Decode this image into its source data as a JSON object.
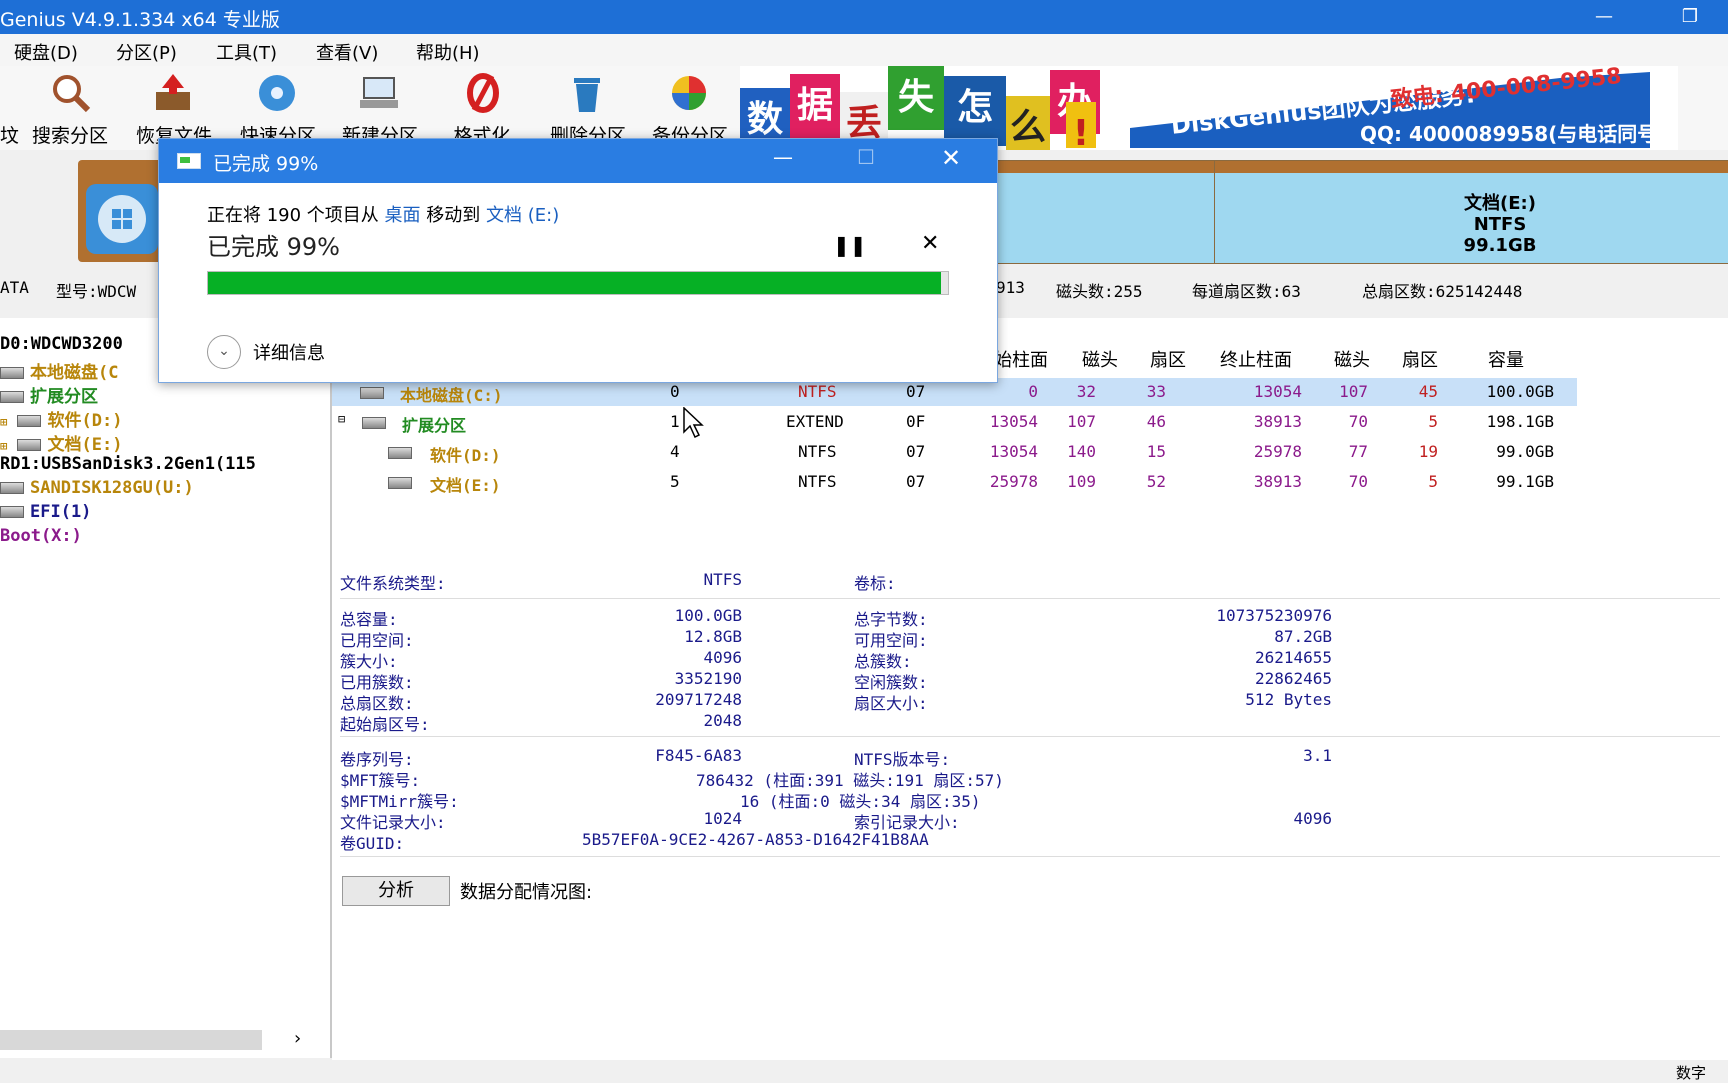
{
  "window": {
    "title": "Genius V4.9.1.334 x64 专业版"
  },
  "menu": [
    "硬盘(D)",
    "分区(P)",
    "工具(T)",
    "查看(V)",
    "帮助(H)"
  ],
  "toolbar": {
    "partial_left": "坟",
    "buttons": [
      "搜索分区",
      "恢复文件",
      "快速分区",
      "新建分区",
      "格式化",
      "删除分区",
      "备份分区"
    ]
  },
  "banner": {
    "tiles": [
      "数",
      "据",
      "丢",
      "失",
      "怎",
      "么",
      "办",
      "!"
    ],
    "team": "DiskGenius团队为您服务!",
    "phone": "致电: 400-008-9958",
    "qq": "QQ: 4000089958(与电话同号)"
  },
  "diskmap": {
    "right_partition": {
      "name": "文档(E:)",
      "fs": "NTFS",
      "size": "99.1GB"
    }
  },
  "disk_info": {
    "prefix": "ATA",
    "model_label": "型号:WDCW",
    "cyl_tail": "913",
    "heads": "磁头数:255",
    "sectors_per_track": "每道扇区数:63",
    "total_sectors": "总扇区数:625142448"
  },
  "tree": {
    "items": [
      "D0:WDCWD3200",
      "本地磁盘(C",
      "扩展分区",
      "软件(D:)",
      "文档(E:)",
      "RD1:USBSanDisk3.2Gen1(115",
      "SANDISK128GU(U:)",
      "EFI(1)",
      "Boot(X:)"
    ]
  },
  "table": {
    "headers": [
      "始柱面",
      "磁头",
      "扇区",
      "终止柱面",
      "磁头",
      "扇区",
      "容量"
    ],
    "rows": [
      {
        "name": "本地磁盘(C:)",
        "no": "0",
        "fs": "NTFS",
        "id": "07",
        "sc": "0",
        "sh": "32",
        "ss": "33",
        "ec": "13054",
        "eh": "107",
        "es": "45",
        "size": "100.0GB"
      },
      {
        "name": "扩展分区",
        "no": "1",
        "fs": "EXTEND",
        "id": "0F",
        "sc": "13054",
        "sh": "107",
        "ss": "46",
        "ec": "38913",
        "eh": "70",
        "es": "5",
        "size": "198.1GB"
      },
      {
        "name": "软件(D:)",
        "no": "4",
        "fs": "NTFS",
        "id": "07",
        "sc": "13054",
        "sh": "140",
        "ss": "15",
        "ec": "25978",
        "eh": "77",
        "es": "19",
        "size": "99.0GB"
      },
      {
        "name": "文档(E:)",
        "no": "5",
        "fs": "NTFS",
        "id": "07",
        "sc": "25978",
        "sh": "109",
        "ss": "52",
        "ec": "38913",
        "eh": "70",
        "es": "5",
        "size": "99.1GB"
      }
    ]
  },
  "props": {
    "fs_type_label": "文件系统类型:",
    "fs_type": "NTFS",
    "vol_label": "卷标:",
    "total_cap_label": "总容量:",
    "total_cap": "100.0GB",
    "total_bytes_label": "总字节数:",
    "total_bytes": "107375230976",
    "used_label": "已用空间:",
    "used": "12.8GB",
    "free_label": "可用空间:",
    "free": "87.2GB",
    "cluster_label": "簇大小:",
    "cluster": "4096",
    "total_clusters_label": "总簇数:",
    "total_clusters": "26214655",
    "used_clusters_label": "已用簇数:",
    "used_clusters": "3352190",
    "free_clusters_label": "空闲簇数:",
    "free_clusters": "22862465",
    "total_sectors_label": "总扇区数:",
    "total_sectors": "209717248",
    "sector_size_label": "扇区大小:",
    "sector_size": "512 Bytes",
    "start_sector_label": "起始扇区号:",
    "start_sector": "2048",
    "serial_label": "卷序列号:",
    "serial": "F845-6A83",
    "ntfs_ver_label": "NTFS版本号:",
    "ntfs_ver": "3.1",
    "mft_label": "$MFT簇号:",
    "mft": "786432 (柱面:391 磁头:191 扇区:57)",
    "mftmirr_label": "$MFTMirr簇号:",
    "mftmirr": "16 (柱面:0 磁头:34 扇区:35)",
    "rec_size_label": "文件记录大小:",
    "rec_size": "1024",
    "idx_size_label": "索引记录大小:",
    "idx_size": "4096",
    "guid_label": "卷GUID:",
    "guid": "5B57EF0A-9CE2-4267-A853-D1642F41B8AA"
  },
  "analyze": {
    "button": "分析",
    "label": "数据分配情况图:"
  },
  "dialog": {
    "title": "已完成 99%",
    "desc_prefix": "正在将 190 个项目从",
    "from": "桌面",
    "mid": "移动到",
    "to": "文档 (E:)",
    "progress_text": "已完成 99%",
    "progress": 0.99,
    "details": "详细信息"
  },
  "statusbar": {
    "right": "数字"
  }
}
